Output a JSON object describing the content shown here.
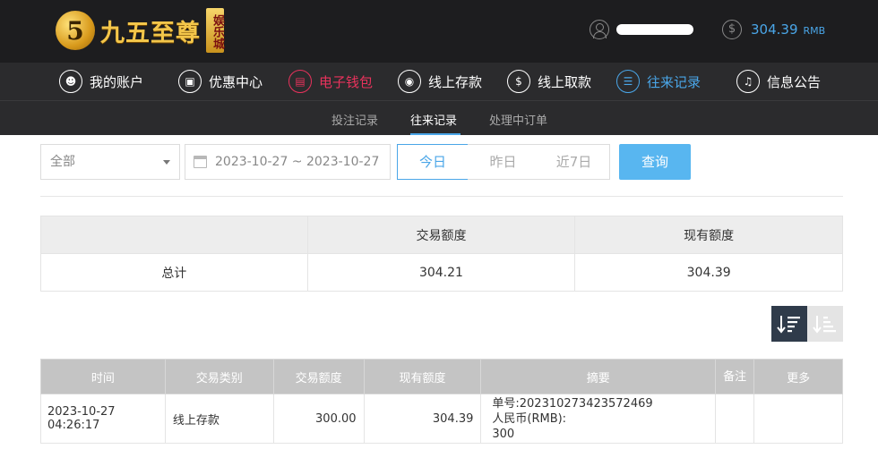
{
  "brand": {
    "badge": "5",
    "name": "九五至尊",
    "tag": "娱乐城"
  },
  "account": {
    "balance": "304.39",
    "currency": "RMB"
  },
  "main_nav": [
    {
      "label": "我的账户",
      "icon": "user-icon"
    },
    {
      "label": "优惠中心",
      "icon": "gift-icon"
    },
    {
      "label": "电子钱包",
      "icon": "wallet-icon"
    },
    {
      "label": "线上存款",
      "icon": "deposit-icon"
    },
    {
      "label": "线上取款",
      "icon": "withdraw-icon"
    },
    {
      "label": "往来记录",
      "icon": "records-icon"
    },
    {
      "label": "信息公告",
      "icon": "bell-icon"
    }
  ],
  "sub_nav": [
    "投注记录",
    "往来记录",
    "处理中订单"
  ],
  "filter": {
    "type_selected": "全部",
    "date_range": "2023-10-27 ~ 2023-10-27",
    "segments": [
      "今日",
      "昨日",
      "近7日"
    ],
    "query_label": "查询"
  },
  "summary": {
    "headers": [
      "",
      "交易额度",
      "现有额度"
    ],
    "row_label": "总计",
    "transaction_amount": "304.21",
    "current_balance": "304.39"
  },
  "records": {
    "headers": [
      "时间",
      "交易类别",
      "交易额度",
      "现有额度",
      "摘要",
      "备注",
      "更多"
    ],
    "rows": [
      {
        "time": "2023-10-27 04:26:17",
        "type": "线上存款",
        "amount": "300.00",
        "balance": "304.39",
        "summary_line1": "单号:202310273423572469",
        "summary_line2": "人民币(RMB):",
        "summary_line3": "300",
        "remark": "",
        "more": ""
      }
    ]
  },
  "colors": {
    "accent_blue": "#4aa6e8",
    "accent_red": "#e8325c",
    "header_bg": "#1d1d1f",
    "nav_bg": "#2b2b2d"
  }
}
